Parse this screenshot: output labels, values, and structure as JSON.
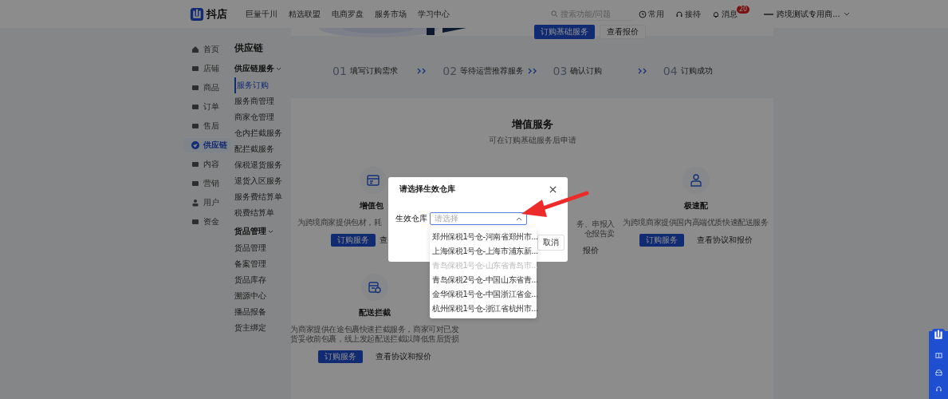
{
  "topbar": {
    "logo": "抖店",
    "nav": [
      "巨量千川",
      "精选联盟",
      "电商罗盘",
      "服务市场",
      "学习中心"
    ],
    "search": {
      "placeholder": "搜索功能/问题"
    },
    "actions": [
      {
        "kind": "clock",
        "label": "常用"
      },
      {
        "kind": "headset",
        "label": "接待"
      },
      {
        "kind": "bell",
        "label": "消息",
        "badge": "20"
      }
    ],
    "account": "跨境测试专用商..."
  },
  "leftnav": [
    {
      "kind": "home",
      "label": "首页",
      "selected": false
    },
    {
      "kind": "shop",
      "label": "店铺",
      "selected": false
    },
    {
      "kind": "goods",
      "label": "商品",
      "selected": false
    },
    {
      "kind": "order",
      "label": "订单",
      "selected": false
    },
    {
      "kind": "aftersale",
      "label": "售后",
      "selected": false
    },
    {
      "kind": "supply",
      "label": "供应链",
      "selected": true
    },
    {
      "kind": "content",
      "label": "内容",
      "selected": false
    },
    {
      "kind": "marketing",
      "label": "营销",
      "selected": false
    },
    {
      "kind": "user",
      "label": "用户",
      "selected": false
    },
    {
      "kind": "money",
      "label": "资金",
      "selected": false
    }
  ],
  "subnav": {
    "title": "供应链",
    "groups": [
      {
        "label": "供应链服务",
        "expanded": true,
        "items": [
          {
            "label": "服务订购",
            "selected": true
          },
          {
            "label": "服务商管理",
            "selected": false
          },
          {
            "label": "商家仓管理",
            "selected": false
          },
          {
            "label": "仓内拦截服务",
            "selected": false
          },
          {
            "label": "配拦截服务",
            "selected": false
          },
          {
            "label": "保税退货服务",
            "selected": false
          },
          {
            "label": "退货入区服务",
            "selected": false
          },
          {
            "label": "服务费结算单",
            "selected": false
          },
          {
            "label": "税费结算单",
            "selected": false
          }
        ]
      },
      {
        "label": "货品管理",
        "expanded": true,
        "items": [
          {
            "label": "货品管理",
            "selected": false
          },
          {
            "label": "备案管理",
            "selected": false
          },
          {
            "label": "货品库存",
            "selected": false
          },
          {
            "label": "溯源中心",
            "selected": false
          },
          {
            "label": "播品报备",
            "selected": false
          },
          {
            "label": "货主绑定",
            "selected": false
          }
        ]
      }
    ]
  },
  "banner": {
    "buttons": [
      {
        "kind": "primary",
        "label": "订购基础服务"
      },
      {
        "kind": "plain",
        "label": "查看报价"
      }
    ]
  },
  "steps": [
    {
      "number": "01",
      "label": "填写订购需求"
    },
    {
      "number": "02",
      "label": "等待运营推荐服务"
    },
    {
      "number": "03",
      "label": "确认订购"
    },
    {
      "number": "04",
      "label": "订购成功"
    }
  ],
  "section": {
    "title": "增值服务",
    "subtitle": "可在订购基础服务后申请",
    "cards": [
      {
        "kind": "cut-left",
        "title": "增值包",
        "description": [
          "为跨境商家提供包材，耗"
        ],
        "order_button": "订购服务",
        "link": "查"
      },
      {
        "kind": "cut-right",
        "description": [
          "务、串报入",
          "仓报告卖"
        ],
        "link": "报价"
      },
      {
        "kind": "full",
        "title": "极速配",
        "description": [
          "为跨境商家提供国内高端优质快速配送服务"
        ],
        "order_button": "订购服务",
        "link": "查看协议和报价"
      },
      {
        "kind": "full",
        "title": "配送拦截",
        "description": [
          "为商家提供在途包裹快速拦截服务，商家可对已发",
          "货妥收前包裹，线上发起配送拦截以降低售后货损"
        ],
        "order_button": "订购服务",
        "link": "查看协议和报价"
      }
    ]
  },
  "modal": {
    "title": "请选择生效仓库",
    "field_label": "生效仓库",
    "select": {
      "placeholder": "请选择",
      "expanded": true
    },
    "cancel": "取消",
    "options": [
      {
        "label": "郑州保税1号仓-河南省郑州市...",
        "disabled": false
      },
      {
        "label": "上海保税1号仓-上海市浦东新...",
        "disabled": false
      },
      {
        "label": "青岛保税1号仓-山东省青岛市...",
        "disabled": true
      },
      {
        "label": "青岛保税2号仓-中国山东省青...",
        "disabled": false
      },
      {
        "label": "金华保税1号仓-中国浙江省金...",
        "disabled": false
      },
      {
        "label": "杭州保税1号仓-浙江省杭州市...",
        "disabled": false
      }
    ]
  }
}
